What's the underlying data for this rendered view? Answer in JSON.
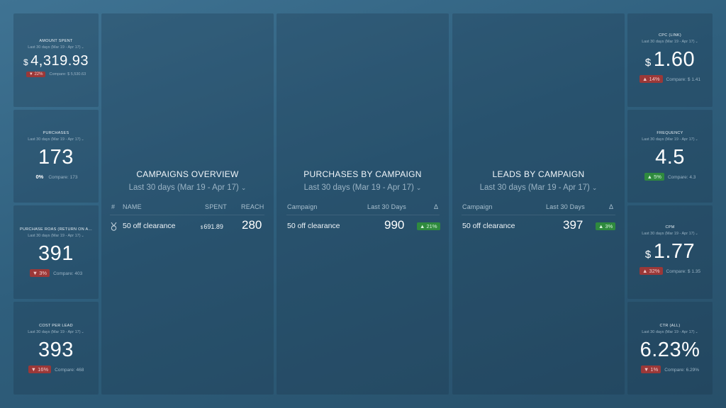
{
  "date_range": "Last 30 days (Mar 19 - Apr 17)",
  "left_kpis": [
    {
      "title": "AMOUNT SPENT",
      "currency": "$",
      "value": "4,319.93",
      "delta": "▼ 22%",
      "delta_color": "red",
      "compare": "Compare: $ 5,530.63"
    },
    {
      "title": "PURCHASES",
      "currency": "",
      "value": "173",
      "delta": "0%",
      "delta_color": "plain",
      "compare": "Compare: 173"
    },
    {
      "title": "PURCHASE ROAS (RETURN ON A...",
      "currency": "",
      "value": "391",
      "delta": "▼ 3%",
      "delta_color": "red",
      "compare": "Compare: 403"
    },
    {
      "title": "COST PER LEAD",
      "currency": "",
      "value": "393",
      "delta": "▼ 16%",
      "delta_color": "red",
      "compare": "Compare: 468"
    }
  ],
  "right_kpis": [
    {
      "title": "CPC (LINK)",
      "currency": "$",
      "value": "1.60",
      "delta": "▲ 14%",
      "delta_color": "red",
      "compare": "Compare: $ 1.41"
    },
    {
      "title": "FREQUENCY",
      "currency": "",
      "value": "4.5",
      "delta": "▲ 5%",
      "delta_color": "green",
      "compare": "Compare: 4.3"
    },
    {
      "title": "CPM",
      "currency": "$",
      "value": "1.77",
      "delta": "▲ 32%",
      "delta_color": "red",
      "compare": "Compare: $ 1.35"
    },
    {
      "title": "CTR (ALL)",
      "currency": "",
      "value": "6.23%",
      "delta": "▼ 1%",
      "delta_color": "red",
      "compare": "Compare: 6.29%"
    }
  ],
  "campaigns_overview": {
    "title": "CAMPAIGNS OVERVIEW",
    "columns": [
      "#",
      "NAME",
      "SPENT",
      "REACH"
    ],
    "rows": [
      {
        "name": "50 off clearance",
        "spent_currency": "$",
        "spent": "691.89",
        "reach": "280"
      }
    ]
  },
  "purchases_by_campaign": {
    "title": "PURCHASES BY CAMPAIGN",
    "columns": [
      "Campaign",
      "Last 30 Days",
      "Δ"
    ],
    "rows": [
      {
        "campaign": "50 off clearance",
        "value": "990",
        "delta": "▲ 21%"
      }
    ]
  },
  "leads_by_campaign": {
    "title": "LEADS BY CAMPAIGN",
    "columns": [
      "Campaign",
      "Last 30 Days",
      "Δ"
    ],
    "rows": [
      {
        "campaign": "50 off clearance",
        "value": "397",
        "delta": "▲ 3%"
      }
    ]
  },
  "colors": {
    "red_badge": "#9b3838",
    "green_badge": "#2f8a3e",
    "background": "#3a6b89"
  }
}
